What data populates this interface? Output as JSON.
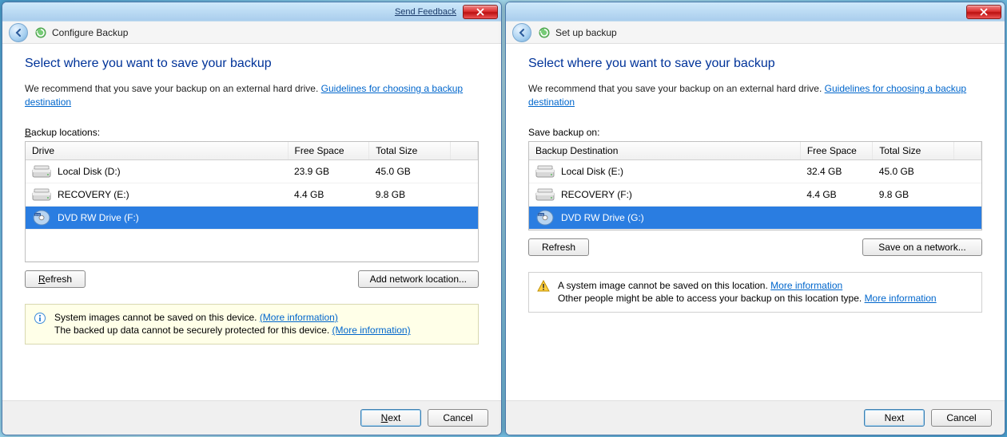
{
  "left": {
    "feedback": "Send Feedback",
    "crumb": "Configure Backup",
    "heading": "Select where you want to save your backup",
    "desc_prefix": "We recommend that you save your backup on an external hard drive. ",
    "guideline_link": "Guidelines for choosing a backup destination",
    "list_label_pre": "B",
    "list_label_rest": "ackup locations:",
    "cols": {
      "drive": "Drive",
      "free": "Free Space",
      "total": "Total Size"
    },
    "rows": [
      {
        "icon": "hdd",
        "name": "Local Disk (D:)",
        "free": "23.9 GB",
        "total": "45.0 GB",
        "selected": false
      },
      {
        "icon": "hdd",
        "name": "RECOVERY (E:)",
        "free": "4.4 GB",
        "total": "9.8 GB",
        "selected": false
      },
      {
        "icon": "dvd",
        "name": "DVD RW Drive (F:)",
        "free": "",
        "total": "",
        "selected": true
      }
    ],
    "refresh_pre": "R",
    "refresh_rest": "efresh",
    "add_net_pre": "Add network l",
    "add_net_accel": "o",
    "add_net_post": "cation...",
    "info_line1_pre": "System images cannot be saved on this device. ",
    "info_link1": "(More information)",
    "info_line2_pre": "The backed up data cannot be securely protected for this device. ",
    "info_link2": "(More information)",
    "next_pre": "N",
    "next_rest": "ext",
    "cancel": "Cancel"
  },
  "right": {
    "crumb": "Set up backup",
    "heading": "Select where you want to save your backup",
    "desc_prefix": "We recommend that you save your backup on an external hard drive. ",
    "guideline_link": "Guidelines for choosing a backup destination",
    "list_label": "Save backup on:",
    "cols": {
      "drive": "Backup Destination",
      "free": "Free Space",
      "total": "Total Size"
    },
    "rows": [
      {
        "icon": "hdd",
        "name": "Local Disk (E:)",
        "free": "32.4 GB",
        "total": "45.0 GB",
        "selected": false
      },
      {
        "icon": "hdd",
        "name": "RECOVERY (F:)",
        "free": "4.4 GB",
        "total": "9.8 GB",
        "selected": false
      },
      {
        "icon": "dvd",
        "name": "DVD RW Drive (G:)",
        "free": "",
        "total": "",
        "selected": true
      }
    ],
    "refresh": "Refresh",
    "save_net": "Save on a network...",
    "warn_line1_pre": "A system image cannot be saved on this location. ",
    "warn_link1": "More information",
    "warn_line2_pre": "Other people might be able to access your backup on this location type. ",
    "warn_link2": "More information",
    "next": "Next",
    "cancel": "Cancel"
  }
}
